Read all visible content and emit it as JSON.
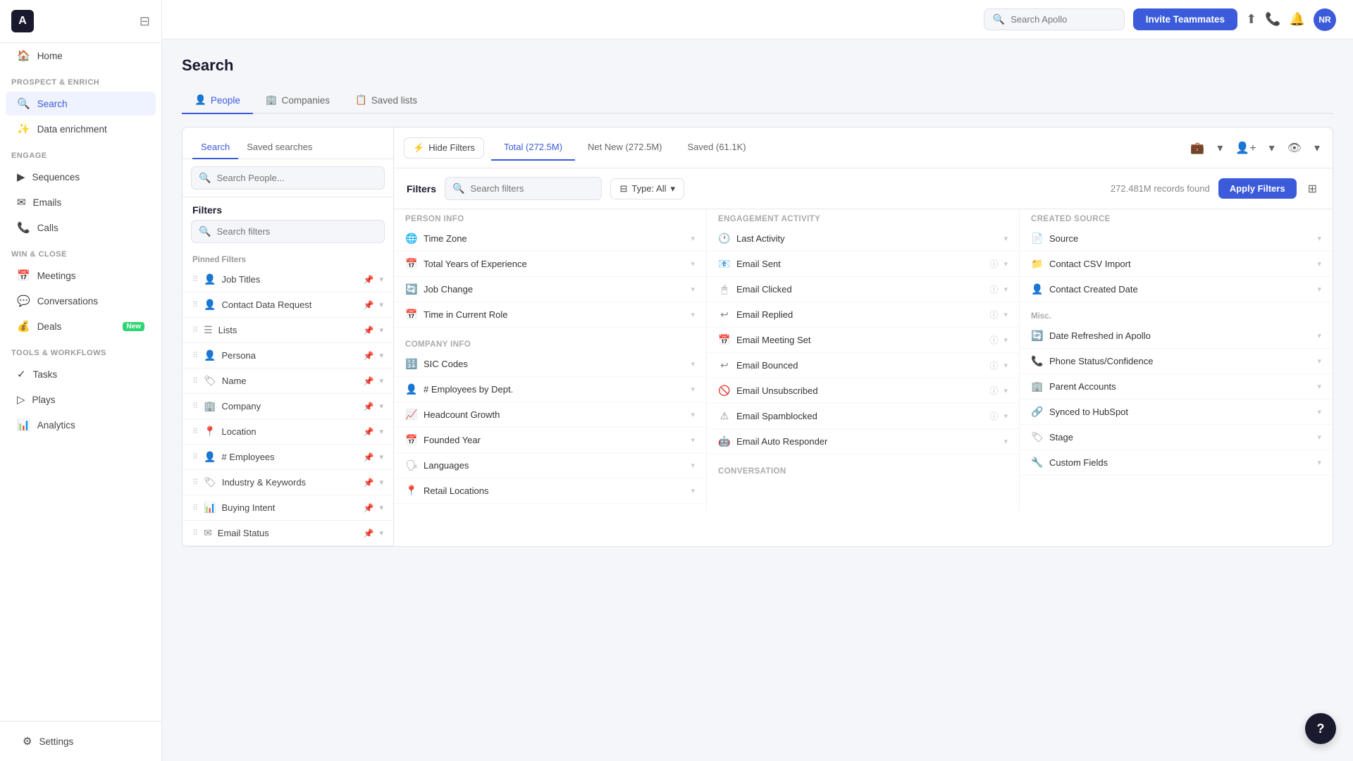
{
  "sidebar": {
    "logo_text": "A",
    "sections": [
      {
        "label": "",
        "items": [
          {
            "id": "home",
            "icon": "🏠",
            "label": "Home",
            "active": false
          }
        ]
      },
      {
        "label": "Prospect & enrich",
        "items": [
          {
            "id": "search",
            "icon": "🔍",
            "label": "Search",
            "active": true
          },
          {
            "id": "data-enrichment",
            "icon": "✨",
            "label": "Data enrichment",
            "active": false
          }
        ]
      },
      {
        "label": "Engage",
        "items": [
          {
            "id": "sequences",
            "icon": "▶",
            "label": "Sequences",
            "active": false
          },
          {
            "id": "emails",
            "icon": "✉",
            "label": "Emails",
            "active": false
          },
          {
            "id": "calls",
            "icon": "📞",
            "label": "Calls",
            "active": false
          }
        ]
      },
      {
        "label": "Win & close",
        "items": [
          {
            "id": "meetings",
            "icon": "📅",
            "label": "Meetings",
            "active": false
          },
          {
            "id": "conversations",
            "icon": "💬",
            "label": "Conversations",
            "active": false
          },
          {
            "id": "deals",
            "icon": "💰",
            "label": "Deals",
            "active": false,
            "badge": "New"
          }
        ]
      },
      {
        "label": "Tools & workflows",
        "items": [
          {
            "id": "tasks",
            "icon": "✓",
            "label": "Tasks",
            "active": false
          },
          {
            "id": "plays",
            "icon": "▷",
            "label": "Plays",
            "active": false
          },
          {
            "id": "analytics",
            "icon": "📊",
            "label": "Analytics",
            "active": false
          }
        ]
      }
    ],
    "settings": {
      "icon": "⚙",
      "label": "Settings"
    }
  },
  "topbar": {
    "search_placeholder": "Search Apollo",
    "invite_btn": "Invite Teammates",
    "avatar": "NR"
  },
  "page": {
    "title": "Search",
    "tabs": [
      {
        "id": "people",
        "icon": "👤",
        "label": "People",
        "active": true
      },
      {
        "id": "companies",
        "icon": "🏢",
        "label": "Companies",
        "active": false
      },
      {
        "id": "saved-lists",
        "icon": "📋",
        "label": "Saved lists",
        "active": false
      }
    ]
  },
  "filter_panel": {
    "subtabs": [
      {
        "id": "search",
        "label": "Search",
        "active": true
      },
      {
        "id": "saved-searches",
        "label": "Saved searches",
        "active": false
      }
    ],
    "search_placeholder": "Search People...",
    "filters_title": "Filters",
    "filter_search_placeholder": "Search filters",
    "type_filter": "Type: All",
    "records_count": "272.481M records found",
    "apply_btn": "Apply Filters",
    "pinned_section": "Pinned Filters",
    "pinned_items": [
      {
        "id": "job-titles",
        "icon": "👤",
        "label": "Job Titles",
        "pinned": true
      },
      {
        "id": "contact-data-request",
        "icon": "👤",
        "label": "Contact Data Request",
        "pinned": true
      },
      {
        "id": "lists",
        "icon": "☰",
        "label": "Lists",
        "pinned": true
      },
      {
        "id": "persona",
        "icon": "👤",
        "label": "Persona",
        "pinned": true
      },
      {
        "id": "name",
        "icon": "🏷",
        "label": "Name",
        "pinned": true
      },
      {
        "id": "company",
        "icon": "🏢",
        "label": "Company",
        "pinned": true
      },
      {
        "id": "location",
        "icon": "📍",
        "label": "Location",
        "pinned": true
      },
      {
        "id": "num-employees",
        "icon": "👤",
        "label": "# Employees",
        "pinned": true
      },
      {
        "id": "industry-keywords",
        "icon": "🏷",
        "label": "Industry & Keywords",
        "pinned": true
      },
      {
        "id": "buying-intent",
        "icon": "📊",
        "label": "Buying Intent",
        "pinned": true
      },
      {
        "id": "email-status",
        "icon": "✉",
        "label": "Email Status",
        "pinned": true
      }
    ]
  },
  "stats_bar": {
    "hide_filters": "Hide Filters",
    "total": "Total (272.5M)",
    "net_new": "Net New (272.5M)",
    "saved": "Saved (61.1K)"
  },
  "filter_columns": [
    {
      "id": "person-info",
      "header": "Person Info",
      "items": [
        {
          "id": "time-zone",
          "icon": "🌐",
          "label": "Time Zone"
        },
        {
          "id": "total-years-experience",
          "icon": "📅",
          "label": "Total Years of Experience"
        },
        {
          "id": "job-change",
          "icon": "🔄",
          "label": "Job Change"
        },
        {
          "id": "time-in-current-role",
          "icon": "📅",
          "label": "Time in Current Role"
        }
      ],
      "sub_header": "Company Info",
      "sub_items": [
        {
          "id": "sic-codes",
          "icon": "🔢",
          "label": "SIC Codes"
        },
        {
          "id": "employees-by-dept",
          "icon": "👤",
          "label": "# Employees by Dept."
        },
        {
          "id": "headcount-growth",
          "icon": "📈",
          "label": "Headcount Growth"
        },
        {
          "id": "founded-year",
          "icon": "📅",
          "label": "Founded Year"
        },
        {
          "id": "languages",
          "icon": "🗣",
          "label": "Languages"
        },
        {
          "id": "retail-locations",
          "icon": "📍",
          "label": "Retail Locations"
        }
      ]
    },
    {
      "id": "engagement-activity",
      "header": "Engagement Activity",
      "items": [
        {
          "id": "last-activity",
          "icon": "🕐",
          "label": "Last Activity"
        },
        {
          "id": "email-sent",
          "icon": "📧",
          "label": "Email Sent",
          "info": true
        },
        {
          "id": "email-clicked",
          "icon": "🖱",
          "label": "Email Clicked",
          "info": true
        },
        {
          "id": "email-replied",
          "icon": "↩",
          "label": "Email Replied",
          "info": true
        },
        {
          "id": "email-meeting-set",
          "icon": "📅",
          "label": "Email Meeting Set",
          "info": true
        },
        {
          "id": "email-bounced",
          "icon": "↩",
          "label": "Email Bounced",
          "info": true
        },
        {
          "id": "email-unsubscribed",
          "icon": "🚫",
          "label": "Email Unsubscribed",
          "info": true
        },
        {
          "id": "email-spamblocked",
          "icon": "⚠",
          "label": "Email Spamblocked",
          "info": true
        },
        {
          "id": "email-auto-responder",
          "icon": "🤖",
          "label": "Email Auto Responder"
        }
      ],
      "sub_header": "Conversation",
      "sub_items": []
    },
    {
      "id": "created-source",
      "header": "Created Source",
      "items": [
        {
          "id": "source",
          "icon": "📄",
          "label": "Source"
        },
        {
          "id": "contact-csv-import",
          "icon": "📁",
          "label": "Contact CSV Import"
        },
        {
          "id": "contact-created-date",
          "icon": "👤",
          "label": "Contact Created Date"
        }
      ],
      "misc_header": "Misc.",
      "misc_items": [
        {
          "id": "date-refreshed",
          "icon": "🔄",
          "label": "Date Refreshed in Apollo"
        },
        {
          "id": "phone-status",
          "icon": "📞",
          "label": "Phone Status/Confidence"
        },
        {
          "id": "parent-accounts",
          "icon": "🏢",
          "label": "Parent Accounts"
        },
        {
          "id": "synced-hubspot",
          "icon": "🔗",
          "label": "Synced to HubSpot"
        },
        {
          "id": "stage",
          "icon": "🏷",
          "label": "Stage"
        },
        {
          "id": "custom-fields",
          "icon": "🔧",
          "label": "Custom Fields"
        }
      ]
    }
  ]
}
